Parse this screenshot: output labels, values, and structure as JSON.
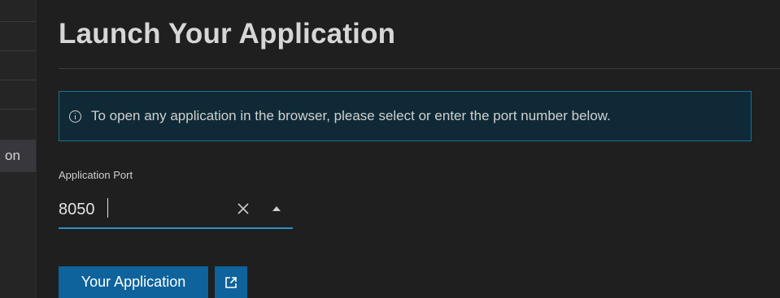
{
  "sidebar": {
    "active_item_label": "on"
  },
  "page": {
    "title": "Launch Your Application"
  },
  "info": {
    "icon": "info-icon",
    "message": "To open any application in the browser, please select or enter the port number below."
  },
  "port_field": {
    "label": "Application Port",
    "value": "8050",
    "clear_icon": "close-icon",
    "toggle_icon": "caret-up-icon"
  },
  "actions": {
    "primary_label": "Your Application",
    "external_icon": "external-link-icon"
  },
  "colors": {
    "accent": "#0e639c",
    "info_border": "#1d6f93",
    "info_background": "#0f2a36",
    "focus_underline": "#2f8fc7"
  }
}
